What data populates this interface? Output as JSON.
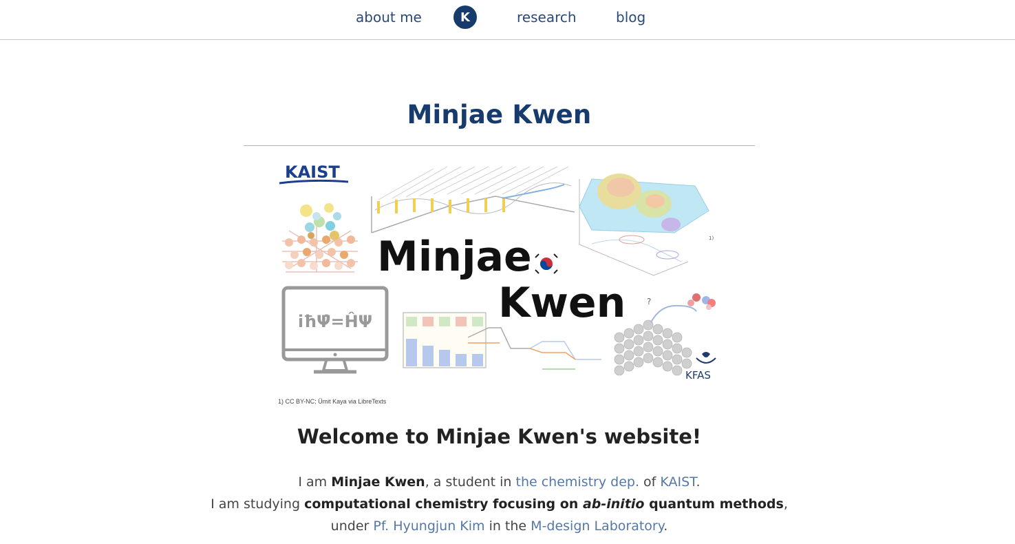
{
  "nav": {
    "about": "about me",
    "logo_letter": "K",
    "research": "research",
    "blog": "blog"
  },
  "header": {
    "title": "Minjae Kwen"
  },
  "banner": {
    "kaist_logo": "KAIST",
    "name_line1": "Minjae",
    "name_line2": "Kwen",
    "equation": "iħΨ̇=ĤΨ",
    "question_mark": "?",
    "kfas_logo": "KFAS",
    "figure_ref": "1)",
    "credit": "1) CC BY-NC; Ümit Kaya via LibreTexts"
  },
  "welcome": {
    "heading": "Welcome to Minjae Kwen's website!"
  },
  "intro": {
    "l1_pre": "I am ",
    "l1_name": "Minjae Kwen",
    "l1_mid": ", a student in ",
    "l1_link1": "the chemistry dep.",
    "l1_of": " of ",
    "l1_link2": "KAIST",
    "l1_end": ".",
    "l2_pre": "I am studying ",
    "l2_bold1": "computational chemistry focusing on ",
    "l2_italic": "ab-initio",
    "l2_bold2": " quantum methods",
    "l2_end": ",",
    "l3_pre": "under ",
    "l3_link1": "Pf. Hyungjun Kim",
    "l3_mid": " in the ",
    "l3_link2": "M-design Laboratory",
    "l3_end": "."
  },
  "colors": {
    "brand": "#173b6c",
    "link": "#5577a6",
    "kaist": "#1a3f8f"
  }
}
